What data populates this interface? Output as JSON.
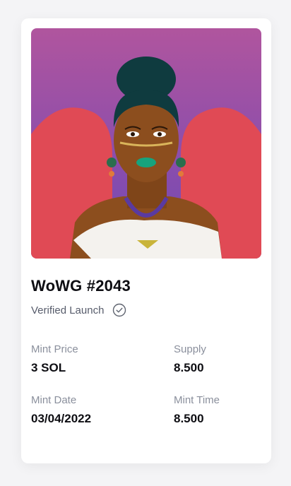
{
  "nft": {
    "artwork": "illustrated-avatar",
    "title": "WoWG #2043",
    "verified_label": "Verified Launch",
    "icon": "verified-check-icon"
  },
  "stats": {
    "mint_price_label": "Mint Price",
    "mint_price_value": "3 SOL",
    "supply_label": "Supply",
    "supply_value": "8.500",
    "mint_date_label": "Mint Date",
    "mint_date_value": "03/04/2022",
    "mint_time_label": "Mint Time",
    "mint_time_value": "8.500"
  },
  "colors": {
    "background": "#f4f4f6",
    "card": "#ffffff",
    "title": "#0d0d12",
    "muted": "#8a8f9c",
    "art_purple_top": "#b0559e",
    "art_purple_bottom": "#6f48b6",
    "art_red": "#e04a55"
  }
}
